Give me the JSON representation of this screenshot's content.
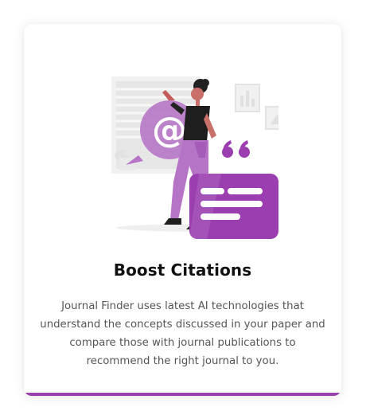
{
  "card": {
    "title": "Boost Citations",
    "description": "Journal Finder uses latest AI technologies that understand the concepts discussed in your paper and compare those with journal publications to recommend the right journal to you.",
    "accent_color": "#9b3fb0"
  },
  "illustration": {
    "icons": [
      "at-sign-icon",
      "quote-icon",
      "speech-bubble-icon",
      "person-figure"
    ]
  }
}
